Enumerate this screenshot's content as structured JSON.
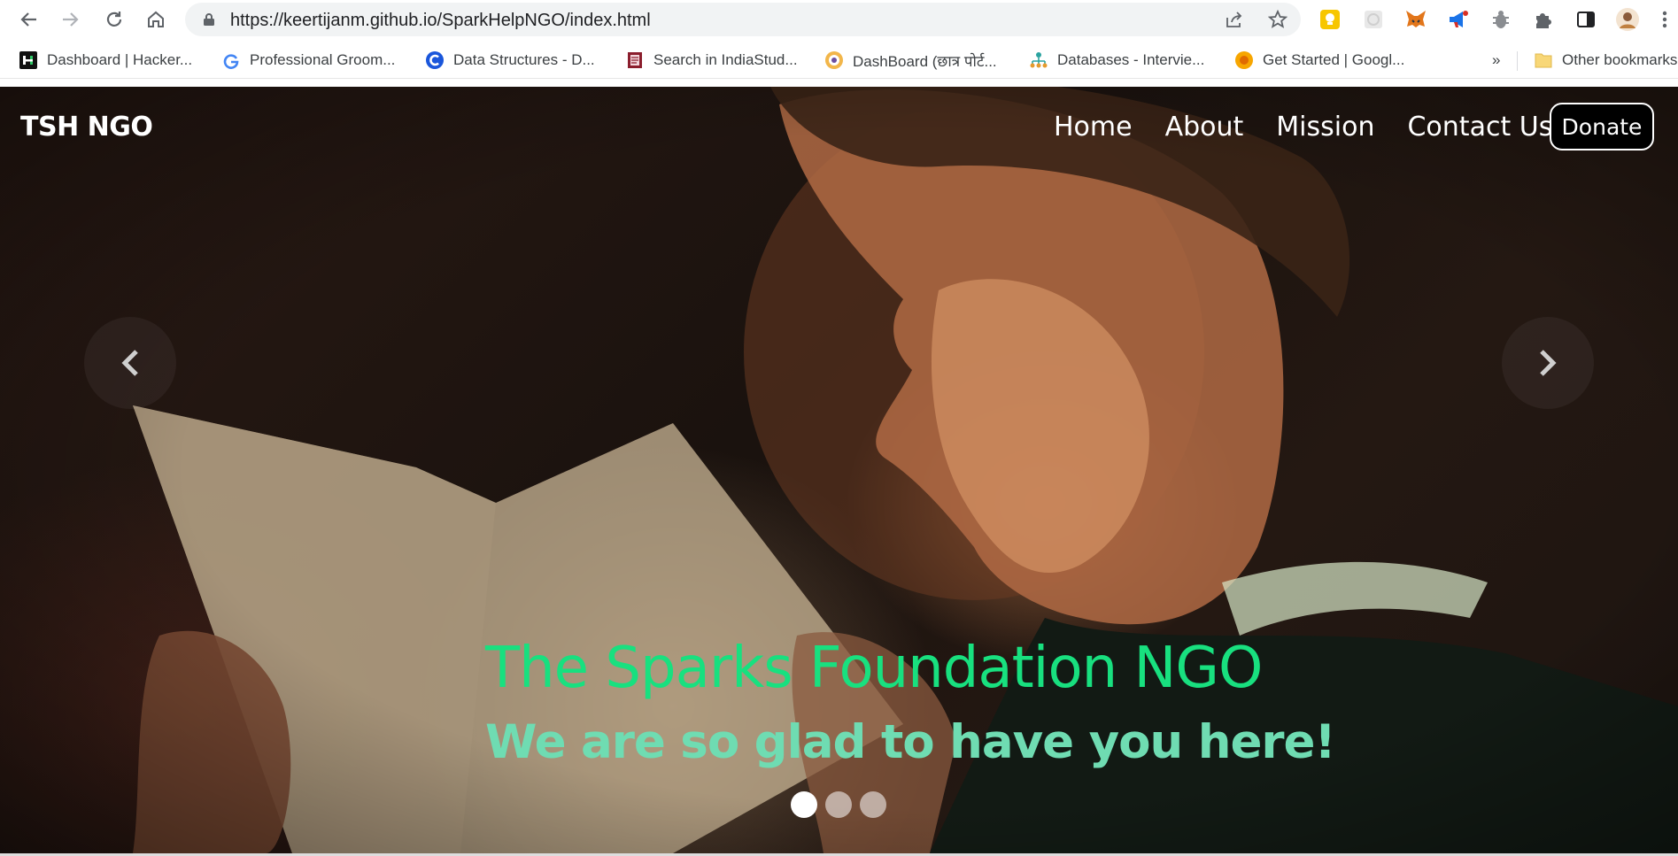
{
  "browser": {
    "url": "https://keertijanm.github.io/SparkHelpNGO/index.html",
    "bookmarks": [
      {
        "label": "Dashboard | Hacker...",
        "icon": "hackerrank-icon"
      },
      {
        "label": "Professional Groom...",
        "icon": "google-g-icon"
      },
      {
        "label": "Data Structures - D...",
        "icon": "c-logo-icon"
      },
      {
        "label": "Search in IndiaStud...",
        "icon": "book-icon"
      },
      {
        "label": "DashBoard (छात्र पोर्ट...",
        "icon": "emblem-icon"
      },
      {
        "label": "Databases - Intervie...",
        "icon": "sitemap-icon"
      },
      {
        "label": "Get Started | Googl...",
        "icon": "sun-icon"
      }
    ],
    "more_bookmarks": "»",
    "other_bookmarks": "Other bookmarks"
  },
  "site": {
    "brand": "TSH NGO",
    "nav": [
      "Home",
      "About",
      "Mission",
      "Contact Us"
    ],
    "donate_label": "Donate",
    "hero": {
      "title": "The Sparks Foundation NGO",
      "subtitle": "We are so glad to have you here!",
      "slide_count": 3,
      "active_slide": 1
    },
    "colors": {
      "title": "#18e07f",
      "subtitle": "#6fdcb2",
      "donate_bg": "#000000"
    }
  }
}
